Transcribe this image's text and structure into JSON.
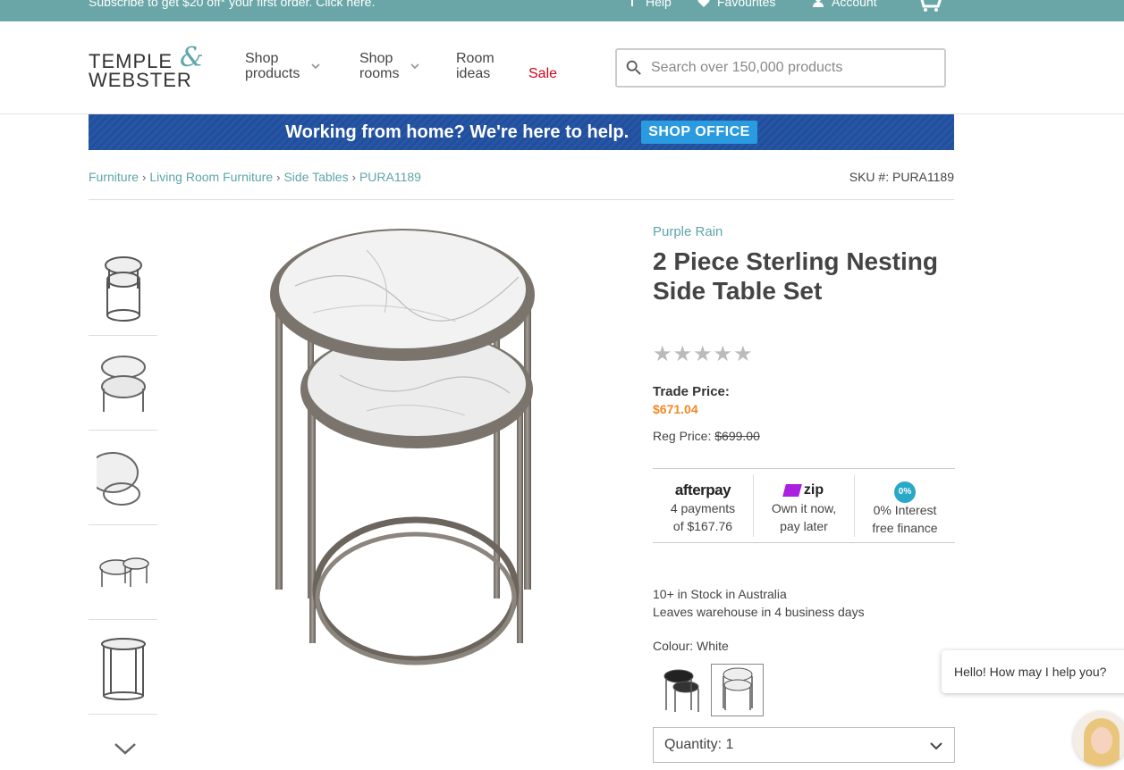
{
  "topbar": {
    "promo": "Subscribe to get $20 off* your first order. Click here.",
    "help": "Help",
    "favourites": "Favourites",
    "account": "Account"
  },
  "header": {
    "logo_line1": "TEMPLE",
    "logo_amp": "&",
    "logo_line2": "WEBSTER",
    "nav": {
      "shop_products_1": "Shop",
      "shop_products_2": "products",
      "shop_rooms_1": "Shop",
      "shop_rooms_2": "rooms",
      "room_ideas_1": "Room",
      "room_ideas_2": "ideas",
      "sale": "Sale"
    },
    "search_placeholder": "Search over 150,000 products"
  },
  "banner": {
    "message": "Working from home? We're here to help.",
    "button": "SHOP OFFICE"
  },
  "breadcrumb": {
    "items": [
      "Furniture",
      "Living Room Furniture",
      "Side Tables",
      "PURA1189"
    ],
    "sku": "SKU #: PURA1189"
  },
  "product": {
    "brand": "Purple Rain",
    "title": "2 Piece Sterling Nesting Side Table Set",
    "stars": "★★★★★",
    "trade_label": "Trade Price:",
    "trade_price": "$671.04",
    "reg_label": "Reg Price:",
    "reg_price": "$699.00",
    "payments": {
      "afterpay_logo": "afterpay",
      "afterpay_1": "4 payments",
      "afterpay_2": "of $167.76",
      "zip_logo": "zip",
      "zip_1": "Own it now,",
      "zip_2": "pay later",
      "interest_logo": "0%",
      "interest_1": "0% Interest",
      "interest_2": "free finance"
    },
    "stock_1": "10+ in Stock in Australia",
    "stock_2": "Leaves warehouse in 4 business days",
    "colour": "Colour: White",
    "quantity": "Quantity: 1"
  },
  "chat": {
    "message": "Hello! How may I help you?"
  },
  "colors": {
    "teal": "#5ea5a9",
    "sale_red": "#d0021b",
    "price_orange": "#f08a24",
    "banner_blue": "#1f4f9e"
  }
}
